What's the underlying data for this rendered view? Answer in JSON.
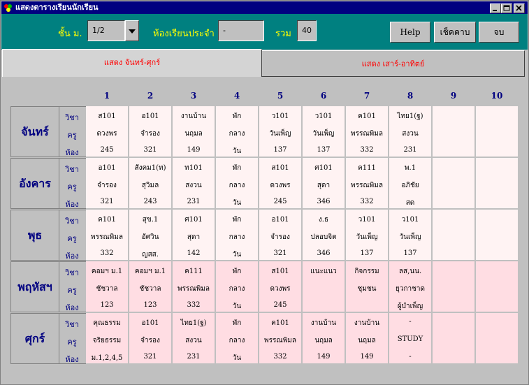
{
  "window": {
    "title": "แสดงตารางเรียนนักเรียน"
  },
  "header": {
    "level_label": "ชั้น ม.",
    "level_value": "1/2",
    "room_label": "ห้องเรียนประจำ",
    "room_value": "-",
    "total_label": "รวม",
    "total_value": "40",
    "help_label": "Help",
    "check_label": "เช็คคาบ",
    "close_label": "จบ"
  },
  "tabs": {
    "mon_fri": "แสดง จันทร์-ศุกร์",
    "sat_sun": "แสดง เสาร์-อาทิตย์"
  },
  "periods": [
    "1",
    "2",
    "3",
    "4",
    "5",
    "6",
    "7",
    "8",
    "9",
    "10"
  ],
  "row_labels": {
    "subject": "วิชา",
    "teacher": "ครู",
    "room": "ห้อง"
  },
  "days": [
    {
      "name": "จันทร์",
      "cells": [
        [
          "ส101",
          "ดวงพร",
          "245"
        ],
        [
          "อ101",
          "จำรอง",
          "321"
        ],
        [
          "งานบ้าน",
          "นฤมล",
          "149"
        ],
        [
          "พัก",
          "กลาง",
          "วัน"
        ],
        [
          "ว101",
          "วันเพ็ญ",
          "137"
        ],
        [
          "ว101",
          "วันเพ็ญ",
          "137"
        ],
        [
          "ค101",
          "พรรณพิมล",
          "332"
        ],
        [
          "ไทย1(ฐ)",
          "สงวน",
          "231"
        ],
        [
          "",
          "",
          ""
        ],
        [
          "",
          "",
          ""
        ]
      ]
    },
    {
      "name": "อังคาร",
      "cells": [
        [
          "อ101",
          "จำรอง",
          "321"
        ],
        [
          "สังคม1(ท)",
          "สุวิมล",
          "243"
        ],
        [
          "ท101",
          "สงวน",
          "231"
        ],
        [
          "พัก",
          "กลาง",
          "วัน"
        ],
        [
          "ส101",
          "ดวงพร",
          "245"
        ],
        [
          "ศ101",
          "สุดา",
          "346"
        ],
        [
          "ค111",
          "พรรณพิมล",
          "332"
        ],
        [
          "พ.1",
          "อภิชัย",
          "สด"
        ],
        [
          "",
          "",
          ""
        ],
        [
          "",
          "",
          ""
        ]
      ]
    },
    {
      "name": "พุธ",
      "cells": [
        [
          "ค101",
          "พรรณพิมล",
          "332"
        ],
        [
          "สุข.1",
          "อัศวิน",
          "ญสส."
        ],
        [
          "ศ101",
          "สุดา",
          "142"
        ],
        [
          "พัก",
          "กลาง",
          "วัน"
        ],
        [
          "อ101",
          "จำรอง",
          "321"
        ],
        [
          "ง.ธ",
          "ปลอบจิต",
          "346"
        ],
        [
          "ว101",
          "วันเพ็ญ",
          "137"
        ],
        [
          "ว101",
          "วันเพ็ญ",
          "137"
        ],
        [
          "",
          "",
          ""
        ],
        [
          "",
          "",
          ""
        ]
      ]
    },
    {
      "name": "พฤหัสฯ",
      "cells": [
        [
          "คอมฯ ม.1",
          "ชัชวาล",
          "123"
        ],
        [
          "คอมฯ ม.1",
          "ชัชวาล",
          "123"
        ],
        [
          "ค111",
          "พรรณพิมล",
          "332"
        ],
        [
          "พัก",
          "กลาง",
          "วัน"
        ],
        [
          "ส101",
          "ดวงพร",
          "245"
        ],
        [
          "แนะแนว",
          "",
          ""
        ],
        [
          "กิจกรรม",
          "ชุมชน",
          ""
        ],
        [
          "ลส,นน.",
          "ยุวกาชาด",
          "ผู้บำเพ็ญ"
        ],
        [
          "",
          "",
          ""
        ],
        [
          "",
          "",
          ""
        ]
      ]
    },
    {
      "name": "ศุกร์",
      "cells": [
        [
          "คุณธรรม",
          "จริยธรรม",
          "ม.1,2,4,5"
        ],
        [
          "อ101",
          "จำรอง",
          "321"
        ],
        [
          "ไทย1(ฐ)",
          "สงวน",
          "231"
        ],
        [
          "พัก",
          "กลาง",
          "วัน"
        ],
        [
          "ค101",
          "พรรณพิมล",
          "332"
        ],
        [
          "งานบ้าน",
          "นฤมล",
          "149"
        ],
        [
          "งานบ้าน",
          "นฤมล",
          "149"
        ],
        [
          "-",
          "STUDY",
          "-"
        ],
        [
          "",
          "",
          ""
        ],
        [
          "",
          "",
          ""
        ]
      ]
    }
  ],
  "colors": {
    "title_bar": "#000080",
    "header_bg": "#008080",
    "label_yellow": "#ffff00",
    "tab_text": "#ff0000",
    "day_text": "#000080",
    "cell_light": "#fff3f3",
    "cell_pink": "#ffdde3"
  }
}
